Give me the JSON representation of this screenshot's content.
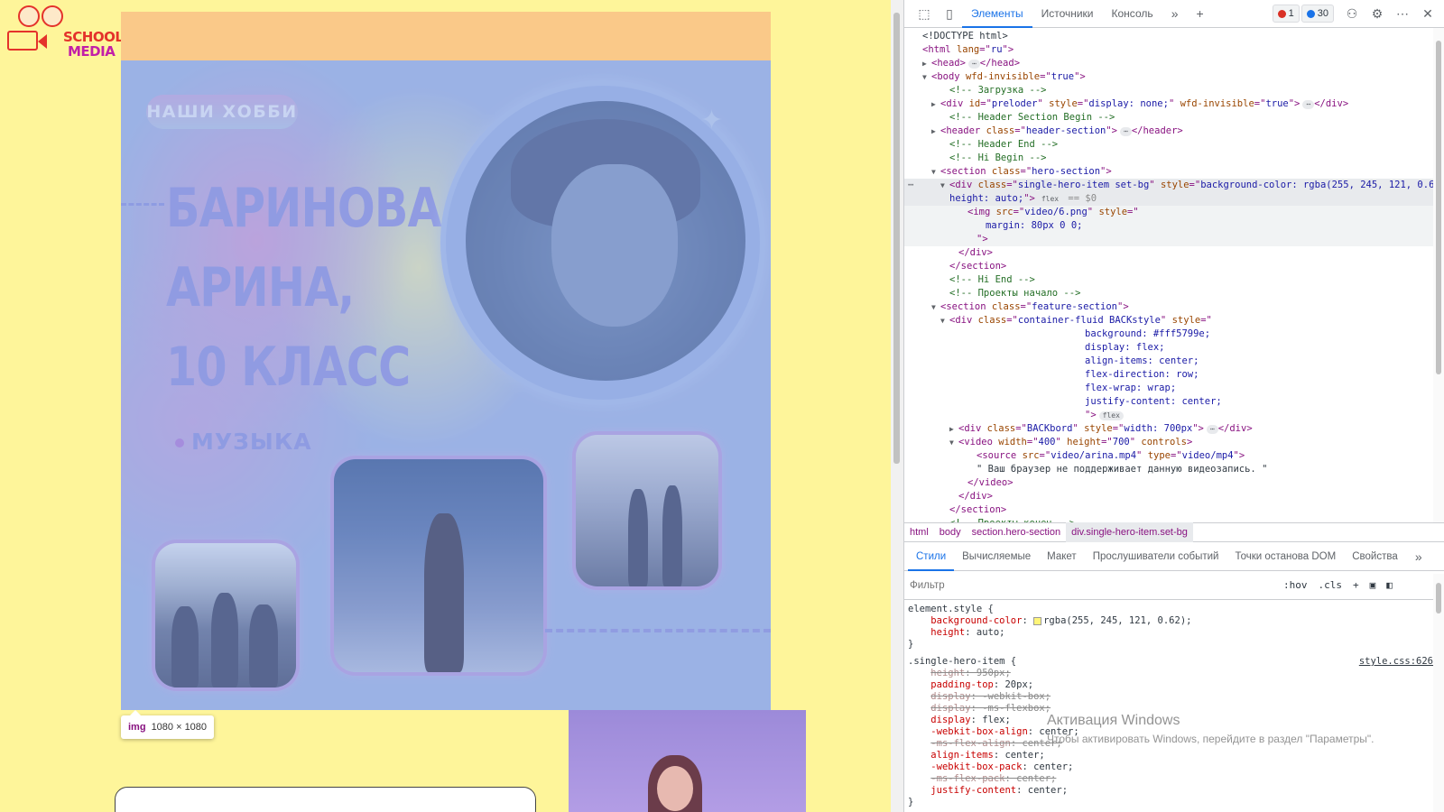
{
  "page": {
    "logo": {
      "line1": "SCHOOL",
      "line2": "MEDIA"
    },
    "hero": {
      "badge": "НАШИ ХОББИ",
      "name_lines": [
        "БАРИНОВА",
        "АРИНА,",
        "10 КЛАСС"
      ],
      "hobby": "МУЗЫКА"
    },
    "tooltip": {
      "tag": "img",
      "size": "1080 × 1080"
    }
  },
  "devtools": {
    "toolbar": {
      "tabs": [
        "Элементы",
        "Источники",
        "Консоль"
      ],
      "errors": "1",
      "messages": "30"
    },
    "dom_lines": [
      {
        "indent": 1,
        "tri": "",
        "html": "<span class='c-txt'>&lt;!DOCTYPE html&gt;</span>"
      },
      {
        "indent": 1,
        "tri": "",
        "html": "<span class='c-tag'>&lt;html </span><span class='c-attr'>lang</span><span class='c-tag'>=\"</span><span class='c-val'>ru</span><span class='c-tag'>\"&gt;</span>"
      },
      {
        "indent": 2,
        "tri": "▶",
        "html": "<span class='c-tag'>&lt;head&gt;</span><span class='pill'>⋯</span><span class='c-tag'>&lt;/head&gt;</span>"
      },
      {
        "indent": 2,
        "tri": "▼",
        "html": "<span class='c-tag'>&lt;body </span><span class='c-attr'>wfd-invisible</span><span class='c-tag'>=\"</span><span class='c-val'>true</span><span class='c-tag'>\"&gt;</span>"
      },
      {
        "indent": 4,
        "tri": "",
        "html": "<span class='c-com'>&lt;!-- Загрузка --&gt;</span>"
      },
      {
        "indent": 3,
        "tri": "▶",
        "html": "<span class='c-tag'>&lt;div </span><span class='c-attr'>id</span><span class='c-tag'>=\"</span><span class='c-val'>preloder</span><span class='c-tag'>\" </span><span class='c-attr'>style</span><span class='c-tag'>=\"</span><span class='c-val'>display: none;</span><span class='c-tag'>\" </span><span class='c-attr'>wfd-invisible</span><span class='c-tag'>=\"</span><span class='c-val'>true</span><span class='c-tag'>\"&gt;</span><span class='pill'>⋯</span><span class='c-tag'>&lt;/div&gt;</span>"
      },
      {
        "indent": 4,
        "tri": "",
        "html": "<span class='c-com'>&lt;!-- Header Section Begin --&gt;</span>"
      },
      {
        "indent": 3,
        "tri": "▶",
        "html": "<span class='c-tag'>&lt;header </span><span class='c-attr'>class</span><span class='c-tag'>=\"</span><span class='c-val'>header-section</span><span class='c-tag'>\"&gt;</span><span class='pill'>⋯</span><span class='c-tag'>&lt;/header&gt;</span>"
      },
      {
        "indent": 4,
        "tri": "",
        "html": "<span class='c-com'>&lt;!-- Header End --&gt;</span>"
      },
      {
        "indent": 4,
        "tri": "",
        "html": "<span class='c-com'>&lt;!-- Hi Begin --&gt;</span>"
      },
      {
        "indent": 3,
        "tri": "▼",
        "html": "<span class='c-tag'>&lt;section </span><span class='c-attr'>class</span><span class='c-tag'>=\"</span><span class='c-val'>hero-section</span><span class='c-tag'>\"&gt;</span>"
      },
      {
        "indent": 4,
        "tri": "▼",
        "sel": true,
        "html": "<span class='c-tag'>&lt;div </span><span class='c-attr'>class</span><span class='c-tag'>=\"</span><span class='c-val'>single-hero-item set-bg</span><span class='c-tag'>\" </span><span class='c-attr'>style</span><span class='c-tag'>=\"</span><span class='c-val'>background-color: rgba(255, 245, 121, 0.62);</span>"
      },
      {
        "indent": 4,
        "tri": "",
        "sel": true,
        "html": "<span class='c-val'>height: auto;</span><span class='c-tag'>\"&gt;</span><span class='pill'>flex</span><span class='c-txt' style='color:#8a8a8a'> == $0</span>"
      },
      {
        "indent": 6,
        "tri": "",
        "sub": true,
        "html": "<span class='c-tag'>&lt;img </span><span class='c-attr'>src</span><span class='c-tag'>=\"</span><span class='c-val'>video/6.png</span><span class='c-tag'>\" </span><span class='c-attr'>style</span><span class='c-tag'>=\"</span>"
      },
      {
        "indent": 8,
        "tri": "",
        "sub": true,
        "html": "<span class='c-val'>margin: 80px 0 0;</span>"
      },
      {
        "indent": 7,
        "tri": "",
        "sub": true,
        "html": "<span class='c-tag'>\"&gt;</span>"
      },
      {
        "indent": 5,
        "tri": "",
        "html": "<span class='c-tag'>&lt;/div&gt;</span>"
      },
      {
        "indent": 4,
        "tri": "",
        "html": "<span class='c-tag'>&lt;/section&gt;</span>"
      },
      {
        "indent": 4,
        "tri": "",
        "html": "<span class='c-com'>&lt;!-- Hi End --&gt;</span>"
      },
      {
        "indent": 4,
        "tri": "",
        "html": "<span class='c-com'>&lt;!-- Проекты начало --&gt;</span>"
      },
      {
        "indent": 3,
        "tri": "▼",
        "html": "<span class='c-tag'>&lt;section </span><span class='c-attr'>class</span><span class='c-tag'>=\"</span><span class='c-val'>feature-section</span><span class='c-tag'>\"&gt;</span>"
      },
      {
        "indent": 4,
        "tri": "▼",
        "html": "<span class='c-tag'>&lt;div </span><span class='c-attr'>class</span><span class='c-tag'>=\"</span><span class='c-val'>container-fluid BACKstyle</span><span class='c-tag'>\" </span><span class='c-attr'>style</span><span class='c-tag'>=\"</span>"
      },
      {
        "indent": 19,
        "tri": "",
        "html": "<span class='c-val'>background: #fff5799e;</span>"
      },
      {
        "indent": 19,
        "tri": "",
        "html": "<span class='c-val'>display: flex;</span>"
      },
      {
        "indent": 19,
        "tri": "",
        "html": "<span class='c-val'>align-items: center;</span>"
      },
      {
        "indent": 19,
        "tri": "",
        "html": "<span class='c-val'>flex-direction: row;</span>"
      },
      {
        "indent": 19,
        "tri": "",
        "html": "<span class='c-val'>flex-wrap: wrap;</span>"
      },
      {
        "indent": 19,
        "tri": "",
        "html": "<span class='c-val'>justify-content: center;</span>"
      },
      {
        "indent": 19,
        "tri": "",
        "html": "<span class='c-tag'>\"&gt;</span><span class='pill'>flex</span>"
      },
      {
        "indent": 5,
        "tri": "▶",
        "html": "<span class='c-tag'>&lt;div </span><span class='c-attr'>class</span><span class='c-tag'>=\"</span><span class='c-val'>BACKbord</span><span class='c-tag'>\" </span><span class='c-attr'>style</span><span class='c-tag'>=\"</span><span class='c-val'>width: 700px</span><span class='c-tag'>\"&gt;</span><span class='pill'>⋯</span><span class='c-tag'>&lt;/div&gt;</span>"
      },
      {
        "indent": 5,
        "tri": "▼",
        "html": "<span class='c-tag'>&lt;video </span><span class='c-attr'>width</span><span class='c-tag'>=\"</span><span class='c-val'>400</span><span class='c-tag'>\" </span><span class='c-attr'>height</span><span class='c-tag'>=\"</span><span class='c-val'>700</span><span class='c-tag'>\" </span><span class='c-attr'>controls</span><span class='c-tag'>&gt;</span>"
      },
      {
        "indent": 7,
        "tri": "",
        "html": "<span class='c-tag'>&lt;source </span><span class='c-attr'>src</span><span class='c-tag'>=\"</span><span class='c-val'>video/arina.mp4</span><span class='c-tag'>\" </span><span class='c-attr'>type</span><span class='c-tag'>=\"</span><span class='c-val'>video/mp4</span><span class='c-tag'>\"&gt;</span>"
      },
      {
        "indent": 7,
        "tri": "",
        "html": "<span class='c-txt'>\" Ваш браузер не поддерживает данную видеозапись. \"</span>"
      },
      {
        "indent": 6,
        "tri": "",
        "html": "<span class='c-tag'>&lt;/video&gt;</span>"
      },
      {
        "indent": 5,
        "tri": "",
        "html": "<span class='c-tag'>&lt;/div&gt;</span>"
      },
      {
        "indent": 4,
        "tri": "",
        "html": "<span class='c-tag'>&lt;/section&gt;</span>"
      },
      {
        "indent": 4,
        "tri": "",
        "html": "<span class='c-com'>&lt;!-- Проекты конец --&gt;</span>"
      }
    ],
    "breadcrumbs": [
      "html",
      "body",
      "section.hero-section",
      "div.single-hero-item.set-bg"
    ],
    "subtabs": [
      "Стили",
      "Вычисляемые",
      "Макет",
      "Прослушиватели событий",
      "Точки останова DOM",
      "Свойства"
    ],
    "filter_placeholder": "Фильтр",
    "filter_tools": [
      ":hov",
      ".cls"
    ],
    "styles": {
      "block1_selector": "element.style {",
      "block1_props": [
        {
          "prop": "background-color",
          "val": "rgba(255, 245, 121, 0.62);",
          "swatch": "#fff579"
        },
        {
          "prop": "height",
          "val": "auto;"
        }
      ],
      "block2_selector": ".single-hero-item {",
      "block2_link": "style.css:626",
      "block2_props": [
        {
          "prop": "height",
          "val": "950px;",
          "strike": true
        },
        {
          "prop": "padding-top",
          "val": "20px;"
        },
        {
          "prop": "display",
          "val": "-webkit-box;",
          "strike": true
        },
        {
          "prop": "display",
          "val": "-ms-flexbox;",
          "strike": true
        },
        {
          "prop": "display",
          "val": "flex;"
        },
        {
          "prop": "-webkit-box-align",
          "val": "center;"
        },
        {
          "prop": "-ms-flex-align",
          "val": "center;",
          "strike": true
        },
        {
          "prop": "align-items",
          "val": "center;"
        },
        {
          "prop": "-webkit-box-pack",
          "val": "center;"
        },
        {
          "prop": "-ms-flex-pack",
          "val": "center;",
          "strike": true
        },
        {
          "prop": "justify-content",
          "val": "center;"
        }
      ]
    },
    "windows_activation": {
      "title": "Активация Windows",
      "subtitle": "Чтобы активировать Windows, перейдите в раздел \"Параметры\"."
    }
  }
}
